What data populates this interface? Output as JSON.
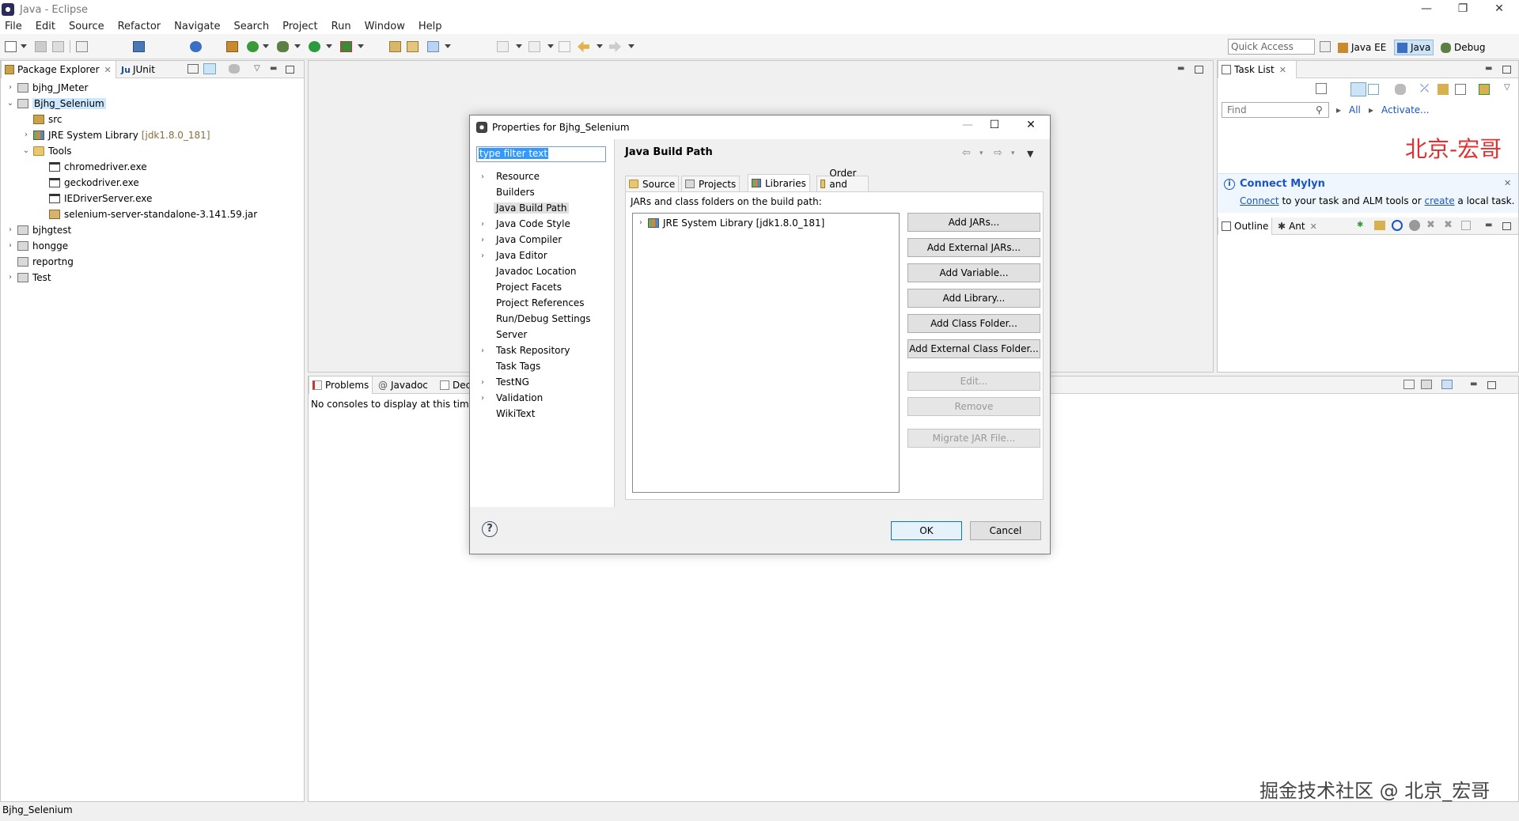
{
  "window": {
    "title": "Java - Eclipse",
    "minimize": "—",
    "restore": "❐",
    "close": "✕"
  },
  "menu": [
    "File",
    "Edit",
    "Source",
    "Refactor",
    "Navigate",
    "Search",
    "Project",
    "Run",
    "Window",
    "Help"
  ],
  "quick_access": "Quick Access",
  "perspectives": [
    "Java EE",
    "Java",
    "Debug"
  ],
  "package_explorer": {
    "tabs": [
      "Package Explorer",
      "JUnit"
    ],
    "junit_prefix": "Ju",
    "items": [
      {
        "label": "bjhg_JMeter",
        "extra": ""
      },
      {
        "label": "Bjhg_Selenium",
        "extra": ""
      },
      {
        "label": "src",
        "extra": ""
      },
      {
        "label": "JRE System Library",
        "extra": "[jdk1.8.0_181]"
      },
      {
        "label": "Tools",
        "extra": ""
      },
      {
        "label": "chromedriver.exe",
        "extra": ""
      },
      {
        "label": "geckodriver.exe",
        "extra": ""
      },
      {
        "label": "IEDriverServer.exe",
        "extra": ""
      },
      {
        "label": "selenium-server-standalone-3.141.59.jar",
        "extra": ""
      },
      {
        "label": "bjhgtest",
        "extra": ""
      },
      {
        "label": "hongge",
        "extra": ""
      },
      {
        "label": "reportng",
        "extra": ""
      },
      {
        "label": "Test",
        "extra": ""
      }
    ]
  },
  "bottom_panel": {
    "tabs": [
      "Problems",
      "Javadoc",
      "Dec"
    ],
    "message": "No consoles to display at this time"
  },
  "task_list": {
    "tab": "Task List",
    "find_placeholder": "Find",
    "all": "All",
    "activate": "Activate...",
    "mylyn_title": "Connect Mylyn",
    "mylyn_connect": "Connect",
    "mylyn_text1": " to your task and ALM tools or ",
    "mylyn_create": "create",
    "mylyn_text2": " a local task."
  },
  "outline": {
    "tabs": [
      "Outline",
      "Ant"
    ]
  },
  "status": "Bjhg_Selenium",
  "dialog": {
    "title": "Properties for Bjhg_Selenium",
    "filter": "type filter text",
    "page_title": "Java Build Path",
    "nav": [
      "Resource",
      "Builders",
      "Java Build Path",
      "Java Code Style",
      "Java Compiler",
      "Java Editor",
      "Javadoc Location",
      "Project Facets",
      "Project References",
      "Run/Debug Settings",
      "Server",
      "Task Repository",
      "Task Tags",
      "TestNG",
      "Validation",
      "WikiText"
    ],
    "subtabs": [
      "Source",
      "Projects",
      "Libraries",
      "Order and Export"
    ],
    "jars_label": "JARs and class folders on the build path:",
    "library": "JRE System Library [jdk1.8.0_181]",
    "buttons": [
      "Add JARs...",
      "Add External JARs...",
      "Add Variable...",
      "Add Library...",
      "Add Class Folder...",
      "Add External Class Folder...",
      "Edit...",
      "Remove",
      "Migrate JAR File..."
    ],
    "ok": "OK",
    "cancel": "Cancel",
    "help": "?"
  },
  "watermarks": {
    "top": "北京-宏哥",
    "bottom": "掘金技术社区 @ 北京_宏哥"
  },
  "colors": {
    "accent": "#0078d7",
    "selection": "#cce8ff",
    "watermark": "#e03030",
    "link": "#1a55c4"
  }
}
